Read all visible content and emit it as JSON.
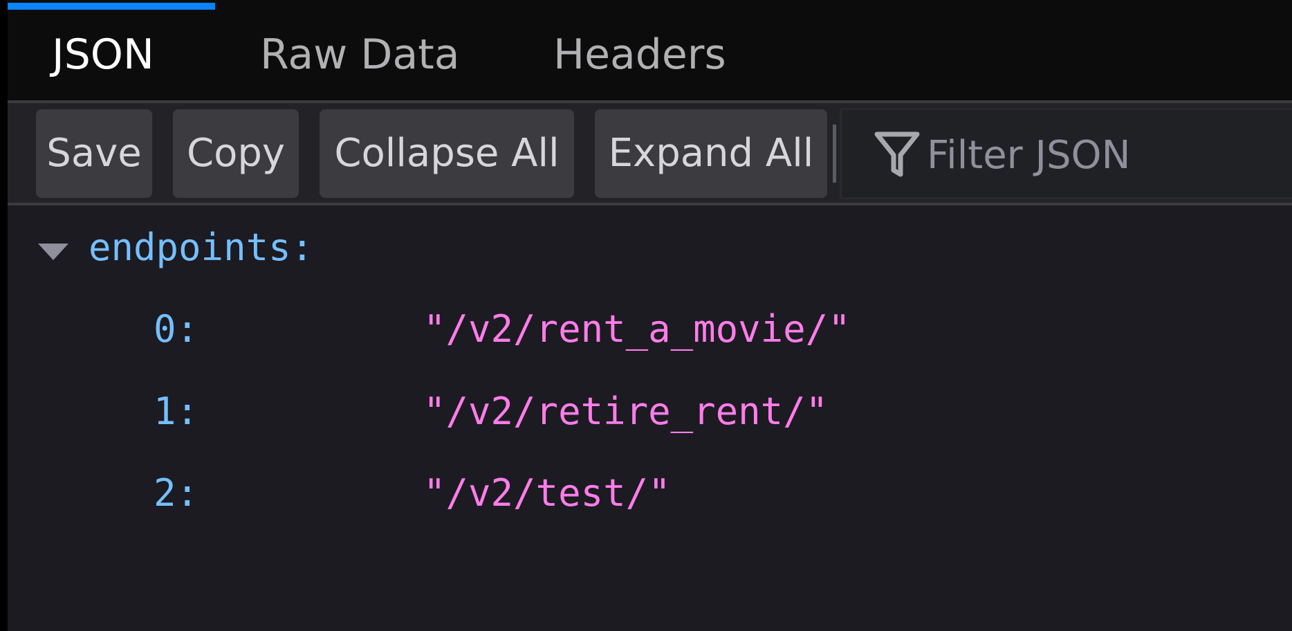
{
  "tabs": [
    {
      "label": "JSON",
      "selected": true
    },
    {
      "label": "Raw Data",
      "selected": false
    },
    {
      "label": "Headers",
      "selected": false
    }
  ],
  "toolbar": {
    "buttons": [
      {
        "label": "Save"
      },
      {
        "label": "Copy"
      },
      {
        "label": "Collapse All"
      },
      {
        "label": "Expand All"
      }
    ],
    "filter": {
      "icon": "filter-icon",
      "placeholder": "Filter JSON",
      "value": ""
    }
  },
  "json": {
    "root_key": "endpoints:",
    "expanded": true,
    "items": [
      {
        "key": "0:",
        "value": "\"/v2/rent_a_movie/\""
      },
      {
        "key": "1:",
        "value": "\"/v2/retire_rent/\""
      },
      {
        "key": "2:",
        "value": "\"/v2/test/\""
      }
    ]
  },
  "colors": {
    "accent": "#0a84ff",
    "key": "#75bfff",
    "string": "#ff7de9",
    "background": "#1c1b22",
    "tabbar": "#0c0c0d"
  }
}
